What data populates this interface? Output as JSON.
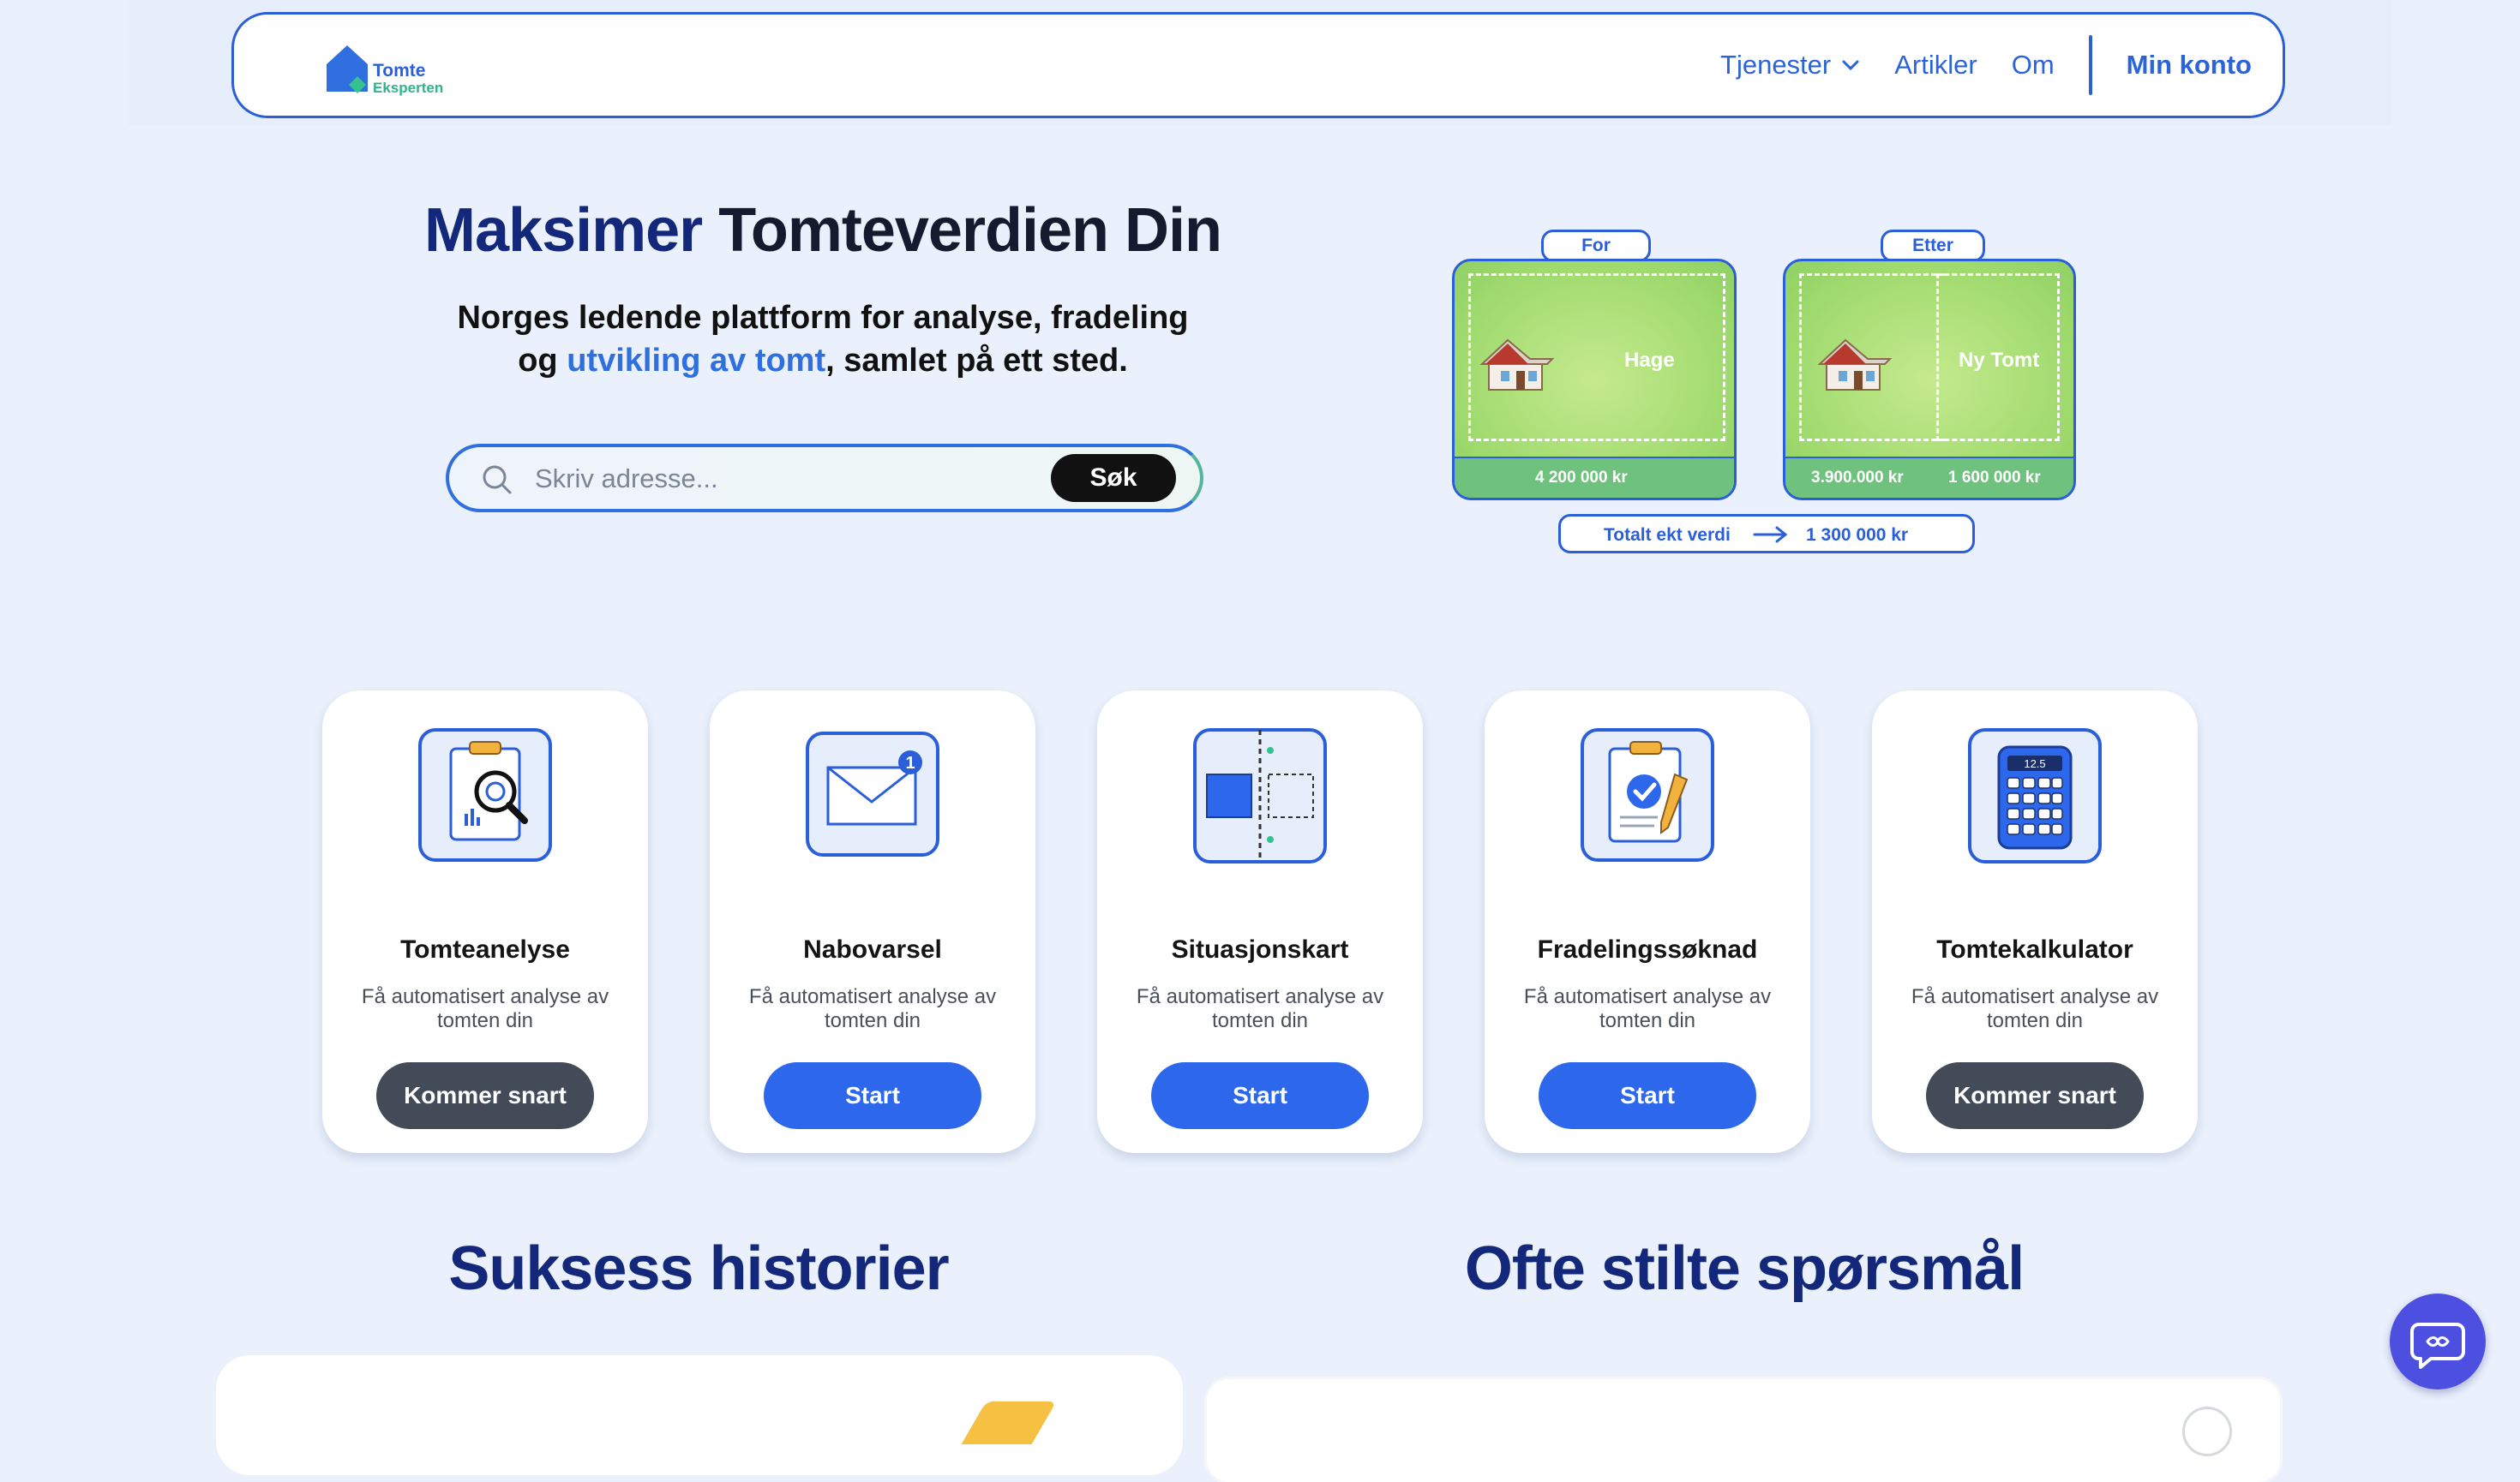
{
  "header": {
    "logo_line1": "Tomte",
    "logo_line2": "Eksperten",
    "nav": {
      "services": "Tjenester",
      "articles": "Artikler",
      "about": "Om",
      "account": "Min konto"
    }
  },
  "hero": {
    "title_part1": "Maksimer",
    "title_part2": "Tomteverdien Din",
    "subtitle_line1": "Norges ledende plattform for analyse, fradeling",
    "subtitle_line2_pre": "og",
    "subtitle_highlight": "utvikling av tomt",
    "subtitle_line2_post": ", samlet på ett sted."
  },
  "search": {
    "placeholder": "Skriv adresse...",
    "button": "Søk"
  },
  "illustration": {
    "before_tag": "For",
    "after_tag": "Etter",
    "before_plot_label": "Hage",
    "after_plot_label": "Ny Tomt",
    "before_value": "4 200 000 kr",
    "after_value_house": "3.900.000 kr",
    "after_value_new": "1 600 000 kr",
    "total_label": "Totalt ekt verdi",
    "total_value": "1 300 000 kr"
  },
  "services": [
    {
      "title": "Tomteanelyse",
      "desc": "Få automatisert analyse av tomten din",
      "button": "Kommer snart",
      "status": "soon",
      "icon": "clipboard-magnifier-icon"
    },
    {
      "title": "Nabovarsel",
      "desc": "Få automatisert analyse av tomten din",
      "button": "Start",
      "status": "active",
      "icon": "envelope-icon",
      "badge": "1"
    },
    {
      "title": "Situasjonskart",
      "desc": "Få automatisert analyse av tomten din",
      "button": "Start",
      "status": "active",
      "icon": "split-map-icon"
    },
    {
      "title": "Fradelingssøknad",
      "desc": "Få automatisert analyse av tomten din",
      "button": "Start",
      "status": "active",
      "icon": "clipboard-check-icon"
    },
    {
      "title": "Tomtekalkulator",
      "desc": "Få automatisert analyse av tomten din",
      "button": "Kommer snart",
      "status": "soon",
      "icon": "calculator-icon",
      "display": "12.5"
    }
  ],
  "sections": {
    "success": "Suksess historier",
    "faq": "Ofte stilte spørsmål"
  },
  "colors": {
    "primary": "#2d68ec",
    "navy": "#13287a",
    "coming_soon": "#434b58",
    "background": "#eaf1fc",
    "chat": "#4c4fe0"
  }
}
